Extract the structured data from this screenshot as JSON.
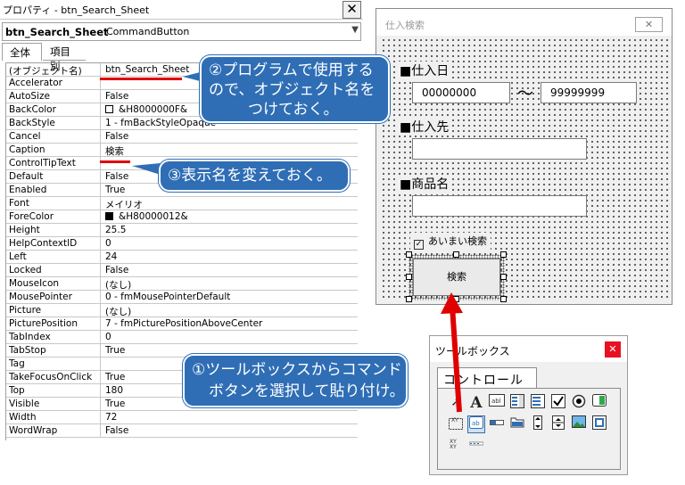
{
  "colors": {
    "accent_red": "#e00000",
    "callout_blue": "#2f6eb5"
  },
  "properties_window": {
    "title": "プロパティ - btn_Search_Sheet",
    "close_glyph": "✕",
    "object_name": "btn_Search_Sheet",
    "object_type": "CommandButton",
    "tabs": [
      "全体",
      "項目別"
    ],
    "rows": [
      {
        "key": "(オブジェクト名)",
        "value": "btn_Search_Sheet"
      },
      {
        "key": "Accelerator",
        "value": ""
      },
      {
        "key": "AutoSize",
        "value": "False"
      },
      {
        "key": "BackColor",
        "value": "&H8000000F&",
        "swatch": "white"
      },
      {
        "key": "BackStyle",
        "value": "1 - fmBackStyleOpaque"
      },
      {
        "key": "Cancel",
        "value": "False"
      },
      {
        "key": "Caption",
        "value": "検索"
      },
      {
        "key": "ControlTipText",
        "value": ""
      },
      {
        "key": "Default",
        "value": "False"
      },
      {
        "key": "Enabled",
        "value": "True"
      },
      {
        "key": "Font",
        "value": "メイリオ"
      },
      {
        "key": "ForeColor",
        "value": "&H80000012&",
        "swatch": "black"
      },
      {
        "key": "Height",
        "value": "25.5"
      },
      {
        "key": "HelpContextID",
        "value": "0"
      },
      {
        "key": "Left",
        "value": "24"
      },
      {
        "key": "Locked",
        "value": "False"
      },
      {
        "key": "MouseIcon",
        "value": "(なし)"
      },
      {
        "key": "MousePointer",
        "value": "0 - fmMousePointerDefault"
      },
      {
        "key": "Picture",
        "value": "(なし)"
      },
      {
        "key": "PicturePosition",
        "value": "7 - fmPicturePositionAboveCenter"
      },
      {
        "key": "TabIndex",
        "value": "0"
      },
      {
        "key": "TabStop",
        "value": "True"
      },
      {
        "key": "Tag",
        "value": ""
      },
      {
        "key": "TakeFocusOnClick",
        "value": "True"
      },
      {
        "key": "Top",
        "value": "180"
      },
      {
        "key": "Visible",
        "value": "True"
      },
      {
        "key": "Width",
        "value": "72"
      },
      {
        "key": "WordWrap",
        "value": "False"
      }
    ]
  },
  "callouts": {
    "c2_line1": "②プログラムで使用する",
    "c2_line2": "ので、オブジェクト名を",
    "c2_line3": "つけておく。",
    "c3": "③表示名を変えておく。",
    "c1_line1": "①ツールボックスからコマンド",
    "c1_line2": "ボタンを選択して貼り付け。"
  },
  "userform": {
    "title": "仕入検索",
    "close_glyph": "✕",
    "label_date": "■仕入日",
    "date_from": "00000000",
    "tilde": "～",
    "date_to": "99999999",
    "label_supplier": "■仕入先",
    "label_product": "■商品名",
    "checkbox_label": "あいまい検索",
    "checkbox_checked": true,
    "search_button": "検索"
  },
  "toolbox": {
    "title": "ツールボックス",
    "close_glyph": "✕",
    "tab": "コントロール",
    "tools_row1": [
      "pointer-icon",
      "label-icon",
      "textbox-icon",
      "combobox-icon",
      "listbox-icon",
      "checkbox-icon",
      "optionbutton-icon",
      "togglebutton-icon"
    ],
    "tools_row2": [
      "frame-icon",
      "commandbutton-icon",
      "tabstrip-icon",
      "multipage-icon",
      "scrollbar-icon",
      "spinbutton-icon",
      "image-icon",
      "refedit-icon"
    ],
    "tools_row3": [
      "xy-icon",
      "slider-icon"
    ]
  }
}
